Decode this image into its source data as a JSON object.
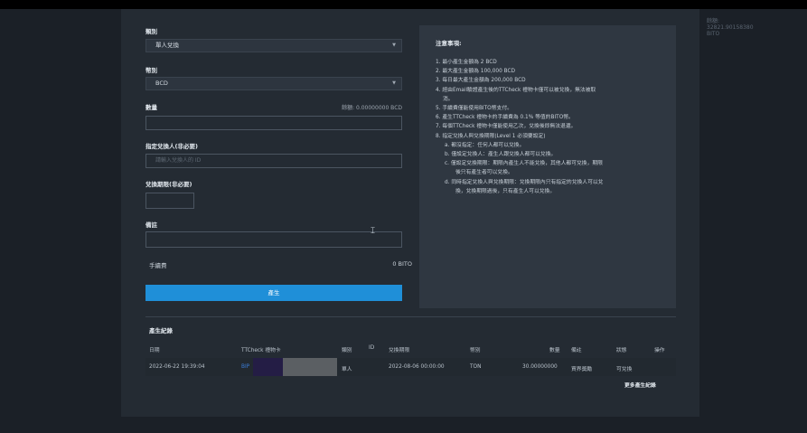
{
  "page": {
    "balance_top": "餘額: 32821.90158380 BITO",
    "cursor_icon": "text-cursor-icon"
  },
  "form": {
    "type_label": "類別",
    "type_value": "單人兌換",
    "currency_label": "幣別",
    "currency_value": "BCD",
    "amount_label": "數量",
    "balance_text": "餘額: 0.00000000 BCD",
    "amount_value": "",
    "recipient_label": "指定兌換人(非必要)",
    "recipient_placeholder": "請輸入兌換人的 ID",
    "period_label": "兌換期限(非必要)",
    "period_value": "",
    "note_label": "備註",
    "note_value": "",
    "fee_label": "手續費",
    "fee_value": "0 BITO",
    "submit_label": "產生"
  },
  "notes": {
    "title": "注意事項:",
    "lines": [
      "1. 最小產生金額為 2 BCD",
      "2. 最大產生金額為 100,000 BCD",
      "3. 每日最大產生金額為 200,000 BCD",
      "4. 經由Email驗證產生後的TTCheck 禮物卡僅可以被兌換，無法被取",
      "消。",
      "5. 手續費僅能使用BITO幣支付。",
      "6. 產生TTCheck 禮物卡的手續費為 0.1% 等值的BITO幣。",
      "7. 每個TTCheck 禮物卡僅能使用乙次，兌換後即無法退還。",
      "8. 指定兌換人與兌換期限(Level 1 必須要設定)",
      "a. 都沒指定：任何人都可以兌換。",
      "b. 僅設定兌換人：產生人跟兌換人都可以兌換。",
      "c. 僅設定兌換期限：期限內產生人不能兌換，其他人都可兌換，期限",
      "後只有產生者可以兌換。",
      "d. 同時指定兌換人與兌換期限：兌換期限內只有指定的兌換人可以兌",
      "換，兌換期限過後，只有產生人可以兌換。"
    ]
  },
  "records": {
    "title": "產生紀錄",
    "headers": [
      "日期",
      "TTCheck 禮物卡",
      "類別",
      "ID",
      "兌換期限",
      "幣別",
      "數量",
      "備註",
      "狀態",
      "操作"
    ],
    "row": {
      "date": "2022-06-22 19:39:04",
      "card": "BIP",
      "type": "單人",
      "id": "",
      "expiry": "2022-08-06 00:00:00",
      "currency": "TON",
      "amount": "30.00000000",
      "note": "買界獎勵",
      "status": "可兌換",
      "action": ""
    },
    "more_label": "更多產生紀錄"
  }
}
